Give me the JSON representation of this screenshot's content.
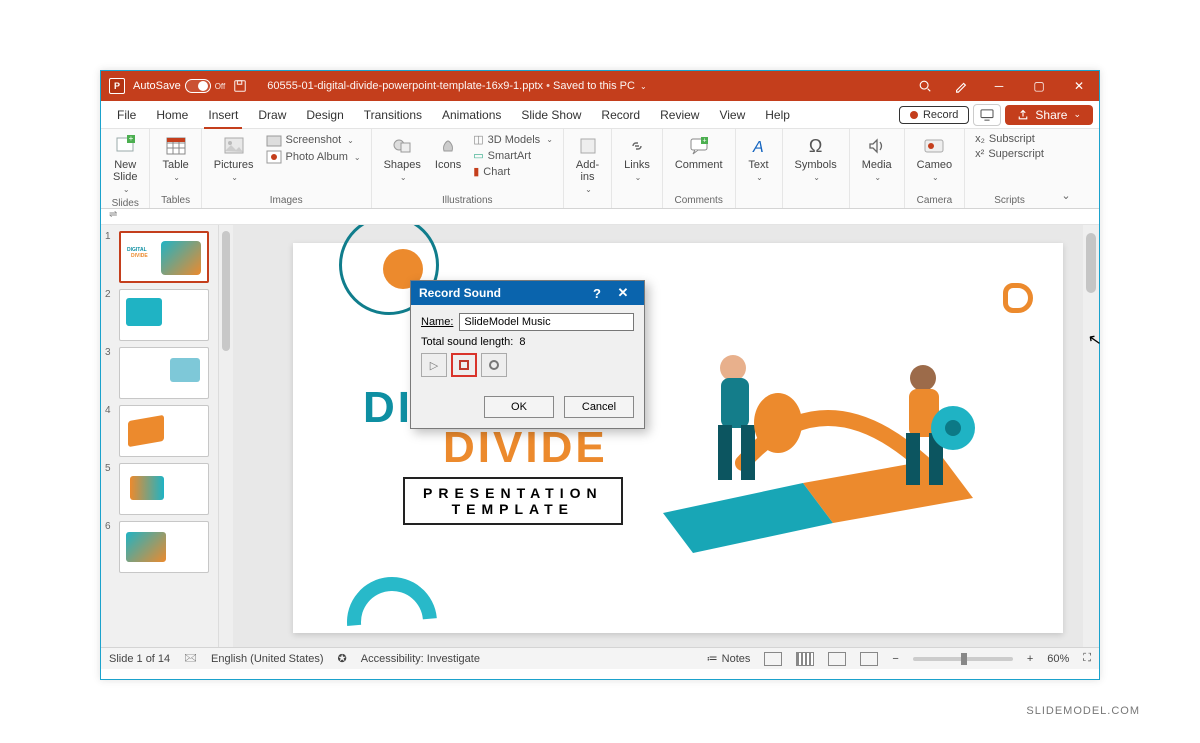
{
  "titlebar": {
    "autosave_label": "AutoSave",
    "autosave_state": "Off",
    "filename": "60555-01-digital-divide-powerpoint-template-16x9-1.pptx",
    "save_state": "Saved to this PC"
  },
  "menu": {
    "tabs": [
      "File",
      "Home",
      "Insert",
      "Draw",
      "Design",
      "Transitions",
      "Animations",
      "Slide Show",
      "Record",
      "Review",
      "View",
      "Help"
    ],
    "active": "Insert",
    "record_btn": "Record",
    "share_btn": "Share"
  },
  "ribbon": {
    "slides_group": "Slides",
    "new_slide": "New\nSlide",
    "tables_group": "Tables",
    "table": "Table",
    "images_group": "Images",
    "pictures": "Pictures",
    "screenshot": "Screenshot",
    "photo_album": "Photo Album",
    "illus_group": "Illustrations",
    "shapes": "Shapes",
    "icons": "Icons",
    "models": "3D Models",
    "smartart": "SmartArt",
    "chart": "Chart",
    "addins": "Add-\nins",
    "links_group": "",
    "links": "Links",
    "comments_group": "Comments",
    "comment": "Comment",
    "text": "Text",
    "symbols": "Symbols",
    "media": "Media",
    "camera_group": "Camera",
    "cameo": "Cameo",
    "scripts_group": "Scripts",
    "subscript": "Subscript",
    "superscript": "Superscript"
  },
  "thumbs": {
    "count": 6
  },
  "slide": {
    "title1": "DIGITAL",
    "title2": "DIVIDE",
    "subtitle1": "PRESENTATION",
    "subtitle2": "TEMPLATE"
  },
  "dialog": {
    "title": "Record Sound",
    "name_label": "Name:",
    "name_value": "SlideModel Music",
    "length_label": "Total sound length:",
    "length_value": "8",
    "ok": "OK",
    "cancel": "Cancel"
  },
  "status": {
    "slide": "Slide 1 of 14",
    "lang": "English (United States)",
    "access": "Accessibility: Investigate",
    "notes": "Notes",
    "zoom": "60%"
  },
  "watermark": "SLIDEMODEL.COM"
}
